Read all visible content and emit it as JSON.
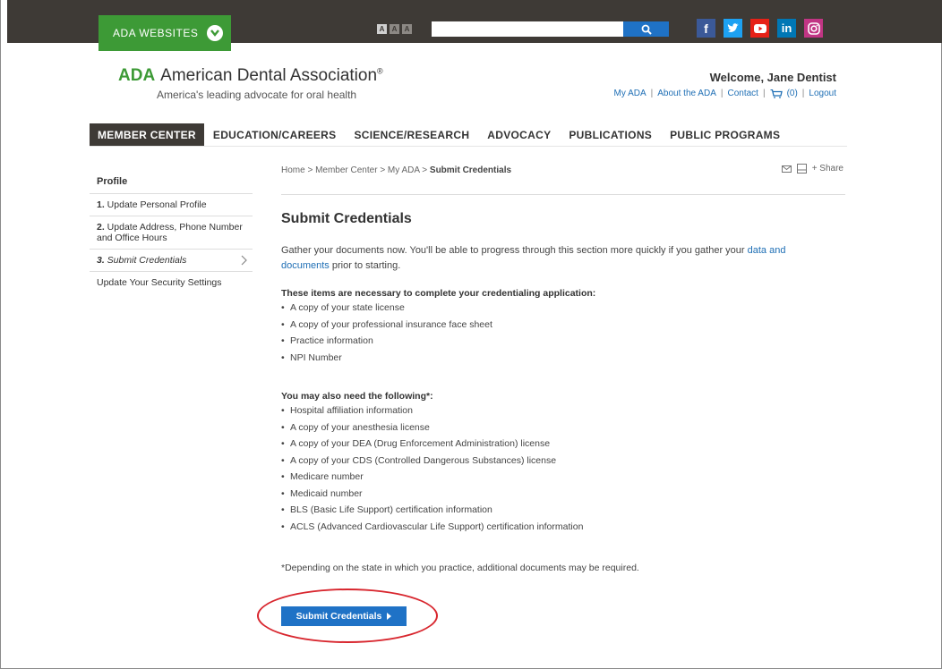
{
  "topbar": {
    "ada_websites_label": "ADA WEBSITES",
    "font_sizes": [
      "A",
      "A",
      "A"
    ],
    "search_placeholder": "",
    "socials": [
      {
        "name": "facebook",
        "glyph": "f",
        "color": "#3b5998"
      },
      {
        "name": "twitter",
        "glyph": "t",
        "color": "#1da1f2"
      },
      {
        "name": "youtube",
        "glyph": "▶",
        "color": "#e62117"
      },
      {
        "name": "linkedin",
        "glyph": "in",
        "color": "#0077b5"
      },
      {
        "name": "instagram",
        "glyph": "◎",
        "color": "#c13584"
      }
    ]
  },
  "header": {
    "logo_abbr": "ADA",
    "logo_name": "American Dental Association",
    "logo_reg": "®",
    "tagline": "America's leading advocate for oral health",
    "welcome": "Welcome, Jane Dentist",
    "utility": {
      "my_ada": "My ADA",
      "about": "About the ADA",
      "contact": "Contact",
      "cart_count": "(0)",
      "logout": "Logout",
      "sep": "|"
    }
  },
  "nav": {
    "items": [
      "MEMBER CENTER",
      "EDUCATION/CAREERS",
      "SCIENCE/RESEARCH",
      "ADVOCACY",
      "PUBLICATIONS",
      "PUBLIC PROGRAMS"
    ]
  },
  "sidebar": {
    "title": "Profile",
    "items": [
      {
        "num": "1.",
        "label": " Update Personal Profile"
      },
      {
        "num": "2.",
        "label": " Update Address, Phone Number and Office Hours"
      },
      {
        "num": "3.",
        "label": " Submit Credentials"
      },
      {
        "num": "",
        "label": "Update Your Security Settings"
      }
    ]
  },
  "breadcrumb": {
    "path": "Home > Member Center > My ADA > ",
    "current": "Submit Credentials"
  },
  "share_label": "+ Share",
  "main": {
    "title": "Submit Credentials",
    "intro_text": "Gather your documents now. You'll be able to progress through this section more quickly if you gather your ",
    "intro_link": "data and documents",
    "intro_end": " prior to starting.",
    "required_heading": "These items are necessary to complete your credentialing application:",
    "required_items": [
      "A copy of your state license",
      "A copy of your professional insurance face sheet",
      "Practice information",
      "NPI Number"
    ],
    "optional_heading": "You may also need the following*:",
    "optional_items": [
      "Hospital affiliation information",
      "A copy of your anesthesia license",
      "A copy of your DEA (Drug Enforcement Administration) license",
      "A copy of your CDS (Controlled Dangerous Substances) license",
      "Medicare number",
      "Medicaid number",
      "BLS (Basic Life Support) certification information",
      "ACLS (Advanced Cardiovascular Life Support) certification information"
    ],
    "footnote": "*Depending on the state in which you practice, additional documents may be required.",
    "submit_label": "Submit Credentials"
  },
  "colors": {
    "topbar": "#3e3a36",
    "brand_green": "#3d9a36",
    "link_blue": "#1f6fb5",
    "button_blue": "#1f72c6",
    "highlight_red": "#d8262e"
  }
}
